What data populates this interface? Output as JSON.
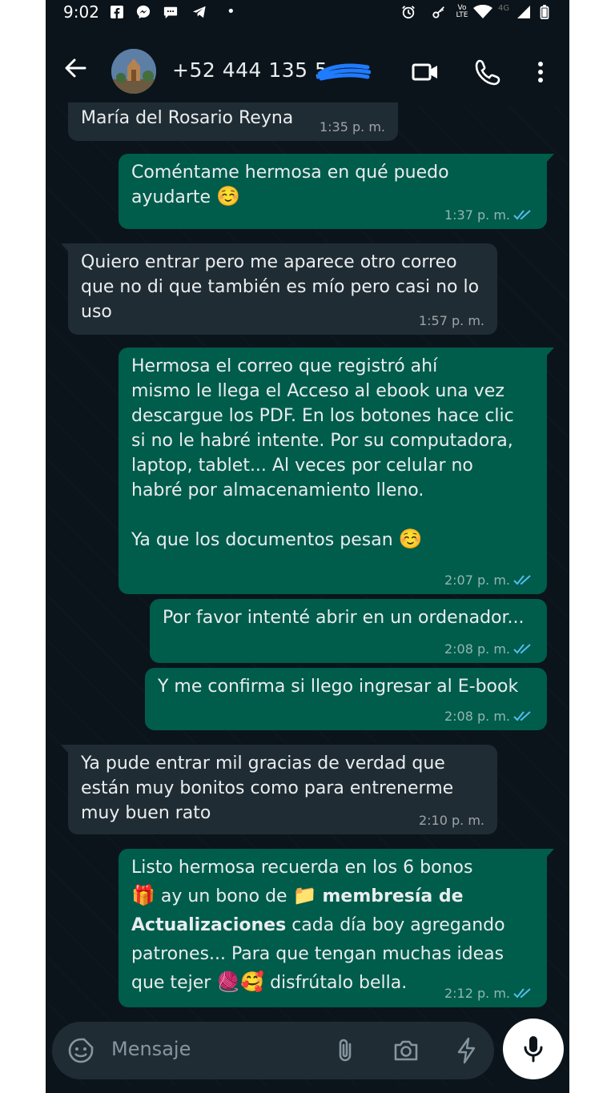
{
  "status_bar": {
    "time": "9:02",
    "network": "4G",
    "volte": "Vo LTE"
  },
  "header": {
    "contact": "+52 444 135 5",
    "icons": [
      "back-arrow-icon",
      "video-call-icon",
      "voice-call-icon",
      "more-options-icon"
    ]
  },
  "messages": [
    {
      "id": "m1",
      "dir": "in",
      "lines": [
        "María del Rosario Reyna"
      ],
      "time": "1:35 p. m."
    },
    {
      "id": "m2",
      "dir": "out",
      "lines": [
        "Coméntame hermosa en qué puedo",
        "ayudarte"
      ],
      "emoji": "☺️",
      "time": "1:37 p. m."
    },
    {
      "id": "m3",
      "dir": "in",
      "lines": [
        "Quiero entrar pero me aparece otro correo",
        "que no di que también es mío pero casi no lo",
        "uso"
      ],
      "time": "1:57 p. m."
    },
    {
      "id": "m4",
      "dir": "out",
      "lines": [
        "Hermosa el correo que registró ahí",
        "mismo le llega el Acceso al ebook una vez",
        "descargue los PDF. En los botones hace clic",
        "si no le habré intente. Por su computadora,",
        "laptop, tablet... Al veces por celular no",
        "habré por almacenamiento lleno.",
        "",
        "Ya que los documentos pesan"
      ],
      "emoji": "☺️",
      "time": "2:07 p. m."
    },
    {
      "id": "m5",
      "dir": "out",
      "lines": [
        "Por favor intenté abrir en un ordenador..."
      ],
      "time": "2:08 p. m."
    },
    {
      "id": "m6",
      "dir": "out",
      "lines": [
        "Y me confirma si llego ingresar al E-book"
      ],
      "time": "2:08 p. m."
    },
    {
      "id": "m7",
      "dir": "in",
      "lines": [
        "Ya pude entrar mil gracias de verdad que",
        "están muy bonitos como para entrenerme",
        "muy buen rato"
      ],
      "time": "2:10 p. m."
    },
    {
      "id": "m8",
      "dir": "out",
      "line1": "Listo hermosa recuerda en los 6 bonos",
      "line2_a": "ay un bono de",
      "line2_bold": "membresía de",
      "line3_bold": "Actualizaciones",
      "line3_b": "cada día boy agregando",
      "line4": "patrones... Para que tengan muchas ideas",
      "line5_a": "que tejer",
      "line5_b": "disfrútalo bella.",
      "emoji_gift": "🎁",
      "emoji_folder": "📁",
      "emoji_yarn": "🧶",
      "emoji_smile_hearts": "🥰",
      "time": "2:12 p. m."
    }
  ],
  "composer": {
    "placeholder": "Mensaje",
    "icons": [
      "sticker-icon",
      "attach-icon",
      "camera-icon",
      "bolt-icon",
      "mic-icon"
    ]
  },
  "colors": {
    "background": "#0b141a",
    "incoming": "#202c33",
    "outgoing": "#005c4b",
    "read_ticks": "#53bdeb"
  }
}
